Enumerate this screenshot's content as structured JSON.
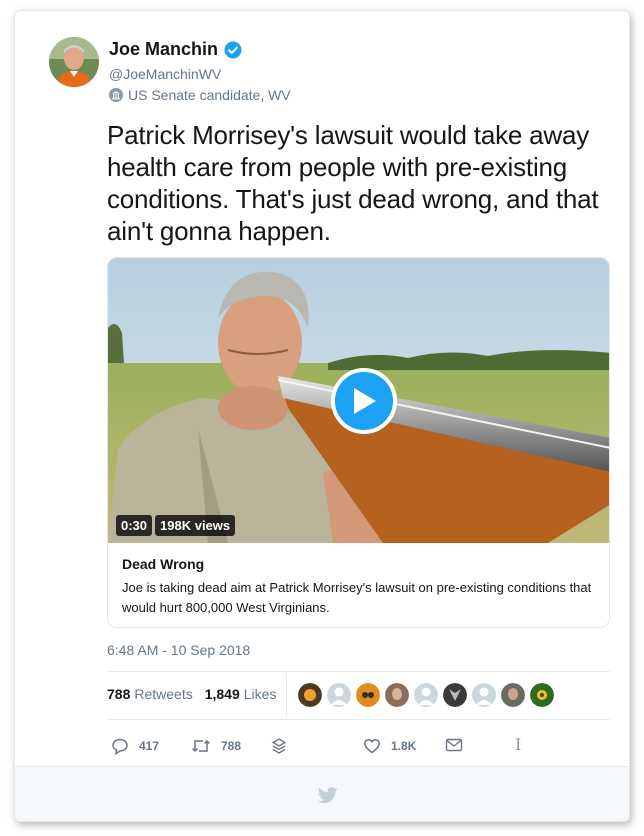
{
  "account": {
    "name": "Joe Manchin",
    "handle": "@JoeManchinWV",
    "label": "US Senate candidate, WV"
  },
  "tweet": {
    "text": "Patrick Morrisey's lawsuit would take away health care from people with pre-existing conditions. That's just dead wrong, and that ain't gonna happen."
  },
  "media": {
    "duration": "0:30",
    "views": "198K views",
    "title": "Dead Wrong",
    "description": "Joe is taking dead aim at Patrick Morrisey's lawsuit on pre-existing conditions that would hurt 800,000 West Virginians."
  },
  "timestamp": "6:48 AM - 10 Sep 2018",
  "stats": {
    "retweets_count": "788",
    "retweets_label": "Retweets",
    "likes_count": "1,849",
    "likes_label": "Likes"
  },
  "actions": {
    "replies": "417",
    "retweets": "788",
    "likes": "1.8K"
  },
  "colors": {
    "accent": "#1da1f2",
    "muted": "#657786",
    "text": "#14171a"
  },
  "icons": [
    "verified-badge-icon",
    "government-icon",
    "play-icon",
    "reply-icon",
    "retweet-icon",
    "stack-icon",
    "heart-icon",
    "message-icon",
    "twitter-bird-icon"
  ]
}
